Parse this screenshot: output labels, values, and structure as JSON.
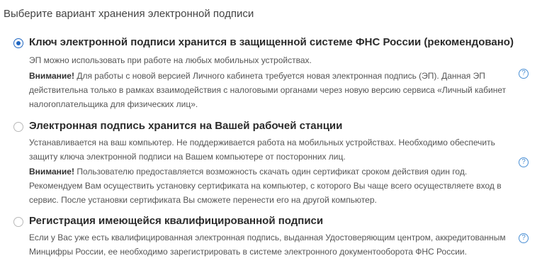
{
  "header": {
    "title": "Выберите вариант хранения электронной подписи"
  },
  "options": [
    {
      "selected": true,
      "title": "Ключ электронной подписи хранится в защищенной системе ФНС России (рекомендовано)",
      "description": "ЭП можно использовать при работе на любых мобильных устройствах.",
      "warning_label": "Внимание!",
      "warning_text": " Для работы с новой версией Личного кабинета требуется новая электронная подпись (ЭП). Данная ЭП  действительна только в рамках взаимодействия с налоговыми органами через новую версию сервиса  «Личный кабинет налогоплательщика для физических лиц».",
      "help_glyph": "?"
    },
    {
      "selected": false,
      "title": "Электронная подпись хранится на Вашей рабочей станции",
      "description": "Устанавливается на ваш компьютер. Не поддерживается работа на мобильных устройствах. Необходимо обеспечить  защиту ключа электронной подписи на Вашем компьютере от посторонних лиц.",
      "warning_label": "Внимание!",
      "warning_text": " Пользователю предоставляется возможность скачать один сертификат  сроком действия один год. Рекомендуем Вам осуществить установку сертификата на компьютер, с которого Вы  чаще всего осуществляете вход в сервис. После установки сертификата Вы сможете перенести его на другой  компьютер.",
      "help_glyph": "?"
    },
    {
      "selected": false,
      "title": "Регистрация имеющейся квалифицированной подписи",
      "description": "Если у Вас уже есть квалифицированная электронная подпись, выданная Удостоверяющим центром, аккредитованным Минцифры России, ее необходимо зарегистрировать в системе электронного документооборота ФНС России.",
      "help_glyph": "?"
    }
  ],
  "colors": {
    "accent": "#1f66c1",
    "help_icon": "#4a8fd4"
  }
}
